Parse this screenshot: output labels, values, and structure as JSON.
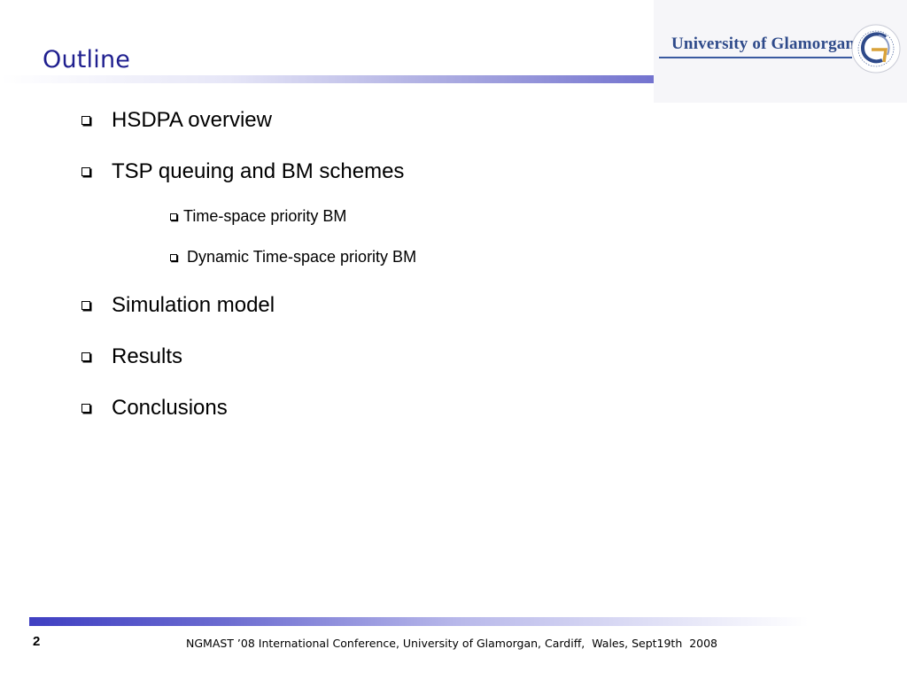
{
  "slide": {
    "title": "Outline",
    "logo": {
      "text": "University of Glamorgan",
      "seal_text": "UNIVERSITY OF GLAMORGAN PRIFYSGOL MORGANNWG"
    },
    "bullets": [
      {
        "text": "HSDPA overview",
        "level": 1
      },
      {
        "text": "TSP queuing and BM schemes",
        "level": 1
      },
      {
        "text": "Time-space priority BM",
        "level": 2
      },
      {
        "text": " Dynamic Time-space priority BM",
        "level": 2
      },
      {
        "text": "Simulation model",
        "level": 1
      },
      {
        "text": "Results",
        "level": 1
      },
      {
        "text": "Conclusions",
        "level": 1
      }
    ],
    "page_number": "2",
    "footer": "NGMAST ’08 International Conference, University of Glamorgan, Cardiff,  Wales, Sept19th  2008",
    "colors": {
      "title": "#1f1f8f",
      "accent": "#3f3fc2",
      "logo": "#2e4a8a"
    }
  }
}
